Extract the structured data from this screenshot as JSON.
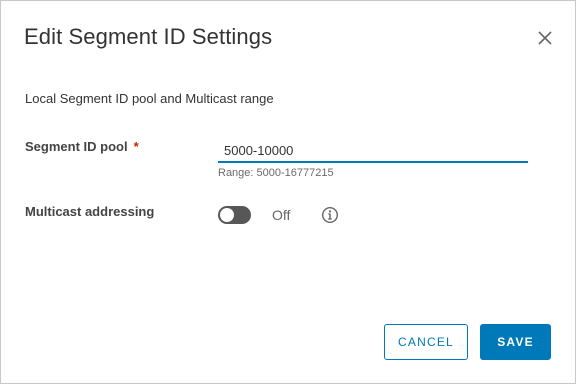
{
  "dialog": {
    "title": "Edit Segment ID Settings",
    "subtitle": "Local Segment ID pool and Multicast range",
    "close_icon": "close-icon"
  },
  "segment_id_pool": {
    "label": "Segment ID pool",
    "required_marker": "*",
    "value": "5000-10000",
    "helper": "Range: 5000-16777215"
  },
  "multicast": {
    "label": "Multicast addressing",
    "toggle_state": "Off",
    "enabled": false,
    "info_icon": "info-icon"
  },
  "footer": {
    "cancel_label": "CANCEL",
    "save_label": "SAVE"
  },
  "colors": {
    "accent": "#0079b8",
    "required": "#c92100",
    "toggle_off": "#575757"
  }
}
